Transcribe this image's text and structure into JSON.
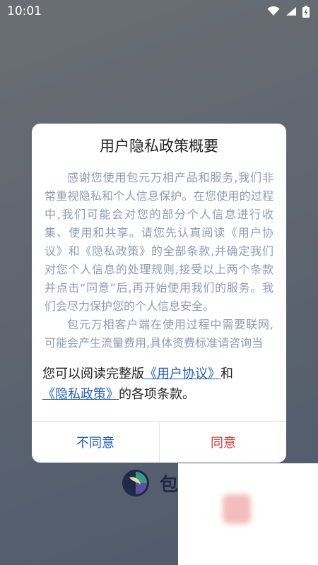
{
  "status_bar": {
    "time": "10:01"
  },
  "dialog": {
    "title": "用户隐私政策概要",
    "paragraphs": [
      "感谢您使用包元万相产品和服务,我们非常重视隐私和个人信息保护。在您使用的过程中,我们可能会对您的部分个人信息进行收集、使用和共享。请您先认真阅读《用户协议》和《隐私政策》的全部条款,并确定我们对您个人信息的处理规则,接受以上两个条款并点击“同意”后,再开始使用我们的服务。我们会尽力保护您的个人信息安全。",
      "包元万相客户端在使用过程中需要联网,可能会产生流量费用,具体资费标准请咨询当"
    ],
    "agreement": {
      "prefix": "您可以阅读完整版",
      "user_agreement_link": "《用户协议》",
      "conjunction": "和",
      "privacy_policy_link": "《隐私政策》",
      "suffix": "的各项条款。"
    },
    "buttons": {
      "disagree": "不同意",
      "agree": "同意"
    },
    "colors": {
      "link": "#1f5fbf",
      "agree": "#d83a3a",
      "body_text": "#8f9bb3"
    }
  },
  "background": {
    "brand_name": "包",
    "logo_icon": "app-logo-icon"
  }
}
